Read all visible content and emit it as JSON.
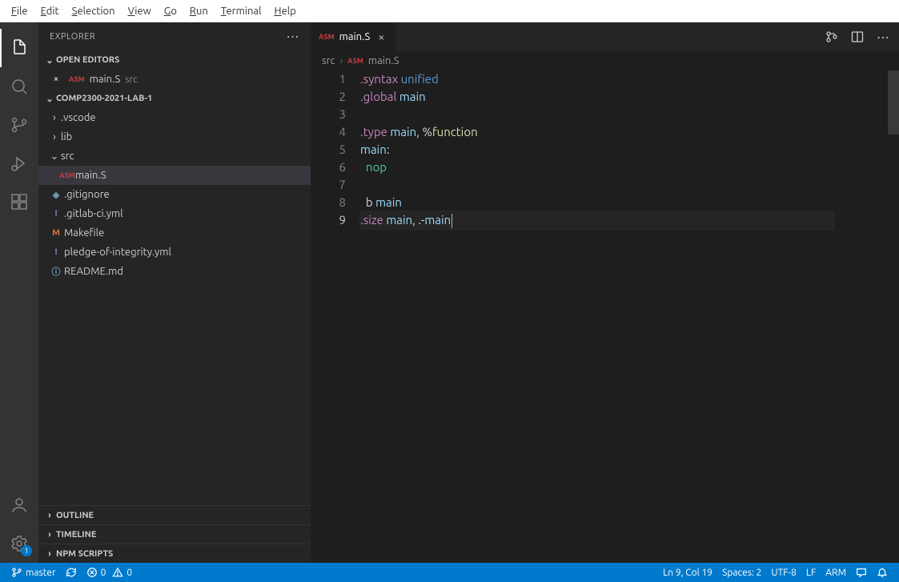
{
  "menubar": [
    "File",
    "Edit",
    "Selection",
    "View",
    "Go",
    "Run",
    "Terminal",
    "Help"
  ],
  "sidebar": {
    "title": "EXPLORER",
    "openEditors": {
      "label": "OPEN EDITORS"
    },
    "openEditorItems": [
      {
        "name": "main.S",
        "hint": "src"
      }
    ],
    "projectName": "COMP2300-2021-LAB-1",
    "tree": [
      {
        "type": "folder",
        "name": ".vscode",
        "expanded": false,
        "depth": 0
      },
      {
        "type": "folder",
        "name": "lib",
        "expanded": false,
        "depth": 0
      },
      {
        "type": "folder",
        "name": "src",
        "expanded": true,
        "depth": 0
      },
      {
        "type": "file",
        "name": "main.S",
        "icon": "asm",
        "depth": 1,
        "selected": true
      },
      {
        "type": "file",
        "name": ".gitignore",
        "icon": "git",
        "depth": 0
      },
      {
        "type": "file",
        "name": ".gitlab-ci.yml",
        "icon": "yml",
        "depth": 0
      },
      {
        "type": "file",
        "name": "Makefile",
        "icon": "make",
        "depth": 0
      },
      {
        "type": "file",
        "name": "pledge-of-integrity.yml",
        "icon": "yml",
        "depth": 0
      },
      {
        "type": "file",
        "name": "README.md",
        "icon": "md",
        "depth": 0
      }
    ],
    "collapsed": [
      "OUTLINE",
      "TIMELINE",
      "NPM SCRIPTS"
    ]
  },
  "tab": {
    "name": "main.S"
  },
  "breadcrumbs": {
    "folder": "src",
    "file": "main.S"
  },
  "code": {
    "lines": [
      {
        "n": 1,
        "html": "<span class='tok-dir'>.syntax</span> <span class='tok-kw'>unified</span>"
      },
      {
        "n": 2,
        "html": "<span class='tok-dir'>.global</span> <span class='tok-id'>main</span>"
      },
      {
        "n": 3,
        "html": ""
      },
      {
        "n": 4,
        "html": "<span class='tok-dir'>.type</span> <span class='tok-id'>main</span><span class='tok-op'>, %</span><span class='tok-fn'>function</span>"
      },
      {
        "n": 5,
        "html": "<span class='tok-id'>main</span><span class='tok-op'>:</span>"
      },
      {
        "n": 6,
        "html": "  <span class='tok-inst'>nop</span>"
      },
      {
        "n": 7,
        "html": ""
      },
      {
        "n": 8,
        "html": "  <span class='tok-op'>b</span> <span class='tok-id'>main</span>"
      },
      {
        "n": 9,
        "html": "<span class='tok-dir'>.size</span> <span class='tok-id'>main</span><span class='tok-op'>, .-</span><span class='tok-id'>main</span><span class='cursor'></span>",
        "current": true
      }
    ]
  },
  "status": {
    "branch": "master",
    "errors": "0",
    "warnings": "0",
    "lncol": "Ln 9, Col 19",
    "spaces": "Spaces: 2",
    "encoding": "UTF-8",
    "eol": "LF",
    "lang": "ARM"
  },
  "activity": {
    "settingsBadge": "1"
  }
}
